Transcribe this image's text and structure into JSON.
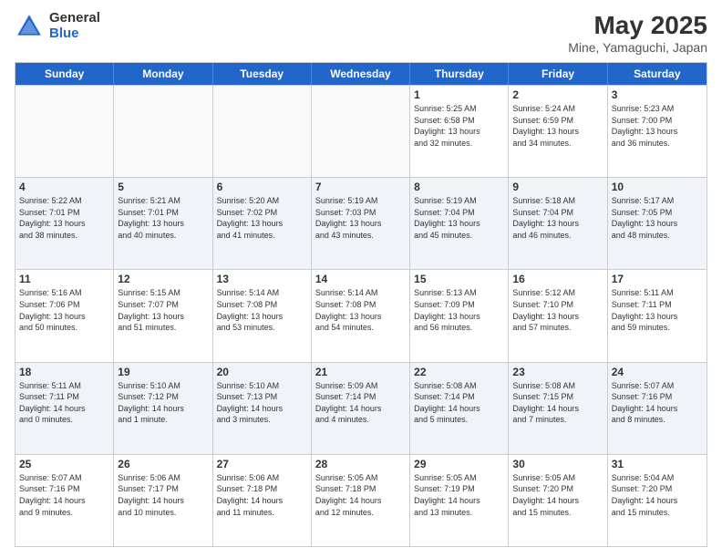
{
  "header": {
    "logo_general": "General",
    "logo_blue": "Blue",
    "main_title": "May 2025",
    "subtitle": "Mine, Yamaguchi, Japan"
  },
  "calendar": {
    "days_of_week": [
      "Sunday",
      "Monday",
      "Tuesday",
      "Wednesday",
      "Thursday",
      "Friday",
      "Saturday"
    ],
    "weeks": [
      [
        {
          "day": "",
          "info": ""
        },
        {
          "day": "",
          "info": ""
        },
        {
          "day": "",
          "info": ""
        },
        {
          "day": "",
          "info": ""
        },
        {
          "day": "1",
          "info": "Sunrise: 5:25 AM\nSunset: 6:58 PM\nDaylight: 13 hours\nand 32 minutes."
        },
        {
          "day": "2",
          "info": "Sunrise: 5:24 AM\nSunset: 6:59 PM\nDaylight: 13 hours\nand 34 minutes."
        },
        {
          "day": "3",
          "info": "Sunrise: 5:23 AM\nSunset: 7:00 PM\nDaylight: 13 hours\nand 36 minutes."
        }
      ],
      [
        {
          "day": "4",
          "info": "Sunrise: 5:22 AM\nSunset: 7:01 PM\nDaylight: 13 hours\nand 38 minutes."
        },
        {
          "day": "5",
          "info": "Sunrise: 5:21 AM\nSunset: 7:01 PM\nDaylight: 13 hours\nand 40 minutes."
        },
        {
          "day": "6",
          "info": "Sunrise: 5:20 AM\nSunset: 7:02 PM\nDaylight: 13 hours\nand 41 minutes."
        },
        {
          "day": "7",
          "info": "Sunrise: 5:19 AM\nSunset: 7:03 PM\nDaylight: 13 hours\nand 43 minutes."
        },
        {
          "day": "8",
          "info": "Sunrise: 5:19 AM\nSunset: 7:04 PM\nDaylight: 13 hours\nand 45 minutes."
        },
        {
          "day": "9",
          "info": "Sunrise: 5:18 AM\nSunset: 7:04 PM\nDaylight: 13 hours\nand 46 minutes."
        },
        {
          "day": "10",
          "info": "Sunrise: 5:17 AM\nSunset: 7:05 PM\nDaylight: 13 hours\nand 48 minutes."
        }
      ],
      [
        {
          "day": "11",
          "info": "Sunrise: 5:16 AM\nSunset: 7:06 PM\nDaylight: 13 hours\nand 50 minutes."
        },
        {
          "day": "12",
          "info": "Sunrise: 5:15 AM\nSunset: 7:07 PM\nDaylight: 13 hours\nand 51 minutes."
        },
        {
          "day": "13",
          "info": "Sunrise: 5:14 AM\nSunset: 7:08 PM\nDaylight: 13 hours\nand 53 minutes."
        },
        {
          "day": "14",
          "info": "Sunrise: 5:14 AM\nSunset: 7:08 PM\nDaylight: 13 hours\nand 54 minutes."
        },
        {
          "day": "15",
          "info": "Sunrise: 5:13 AM\nSunset: 7:09 PM\nDaylight: 13 hours\nand 56 minutes."
        },
        {
          "day": "16",
          "info": "Sunrise: 5:12 AM\nSunset: 7:10 PM\nDaylight: 13 hours\nand 57 minutes."
        },
        {
          "day": "17",
          "info": "Sunrise: 5:11 AM\nSunset: 7:11 PM\nDaylight: 13 hours\nand 59 minutes."
        }
      ],
      [
        {
          "day": "18",
          "info": "Sunrise: 5:11 AM\nSunset: 7:11 PM\nDaylight: 14 hours\nand 0 minutes."
        },
        {
          "day": "19",
          "info": "Sunrise: 5:10 AM\nSunset: 7:12 PM\nDaylight: 14 hours\nand 1 minute."
        },
        {
          "day": "20",
          "info": "Sunrise: 5:10 AM\nSunset: 7:13 PM\nDaylight: 14 hours\nand 3 minutes."
        },
        {
          "day": "21",
          "info": "Sunrise: 5:09 AM\nSunset: 7:14 PM\nDaylight: 14 hours\nand 4 minutes."
        },
        {
          "day": "22",
          "info": "Sunrise: 5:08 AM\nSunset: 7:14 PM\nDaylight: 14 hours\nand 5 minutes."
        },
        {
          "day": "23",
          "info": "Sunrise: 5:08 AM\nSunset: 7:15 PM\nDaylight: 14 hours\nand 7 minutes."
        },
        {
          "day": "24",
          "info": "Sunrise: 5:07 AM\nSunset: 7:16 PM\nDaylight: 14 hours\nand 8 minutes."
        }
      ],
      [
        {
          "day": "25",
          "info": "Sunrise: 5:07 AM\nSunset: 7:16 PM\nDaylight: 14 hours\nand 9 minutes."
        },
        {
          "day": "26",
          "info": "Sunrise: 5:06 AM\nSunset: 7:17 PM\nDaylight: 14 hours\nand 10 minutes."
        },
        {
          "day": "27",
          "info": "Sunrise: 5:06 AM\nSunset: 7:18 PM\nDaylight: 14 hours\nand 11 minutes."
        },
        {
          "day": "28",
          "info": "Sunrise: 5:05 AM\nSunset: 7:18 PM\nDaylight: 14 hours\nand 12 minutes."
        },
        {
          "day": "29",
          "info": "Sunrise: 5:05 AM\nSunset: 7:19 PM\nDaylight: 14 hours\nand 13 minutes."
        },
        {
          "day": "30",
          "info": "Sunrise: 5:05 AM\nSunset: 7:20 PM\nDaylight: 14 hours\nand 15 minutes."
        },
        {
          "day": "31",
          "info": "Sunrise: 5:04 AM\nSunset: 7:20 PM\nDaylight: 14 hours\nand 15 minutes."
        }
      ]
    ]
  }
}
